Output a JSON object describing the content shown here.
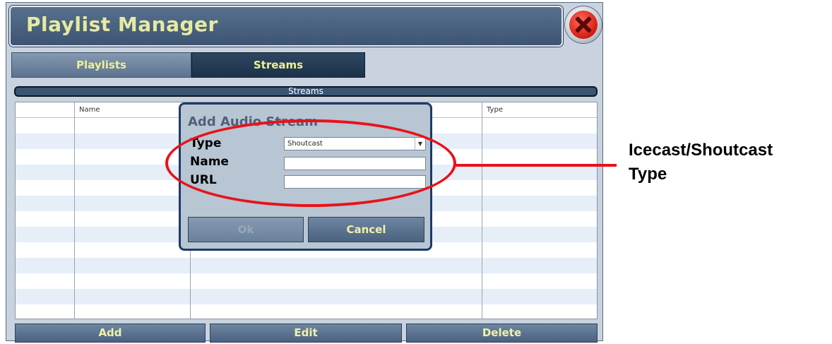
{
  "window": {
    "title": "Playlist Manager",
    "close_icon": "close-icon"
  },
  "tabs": [
    {
      "label": "Playlists",
      "active": false
    },
    {
      "label": "Streams",
      "active": true
    }
  ],
  "panel": {
    "header": "Streams",
    "columns": [
      "",
      "Name",
      "",
      "Type"
    ],
    "rows": 13
  },
  "footer": {
    "add_label": "Add",
    "edit_label": "Edit",
    "delete_label": "Delete"
  },
  "dialog": {
    "title": "Add Audio Stream",
    "type_label": "Type",
    "type_value": "Shoutcast",
    "name_label": "Name",
    "name_value": "",
    "url_label": "URL",
    "url_value": "",
    "ok_label": "Ok",
    "cancel_label": "Cancel"
  },
  "annotation": {
    "line1": "Icecast/Shoutcast",
    "line2": "Type",
    "color": "#e8121a"
  },
  "colors": {
    "title_text": "#e6eaa2",
    "accent_dark": "#1e3a66",
    "row_alt": "#e6eef8"
  }
}
